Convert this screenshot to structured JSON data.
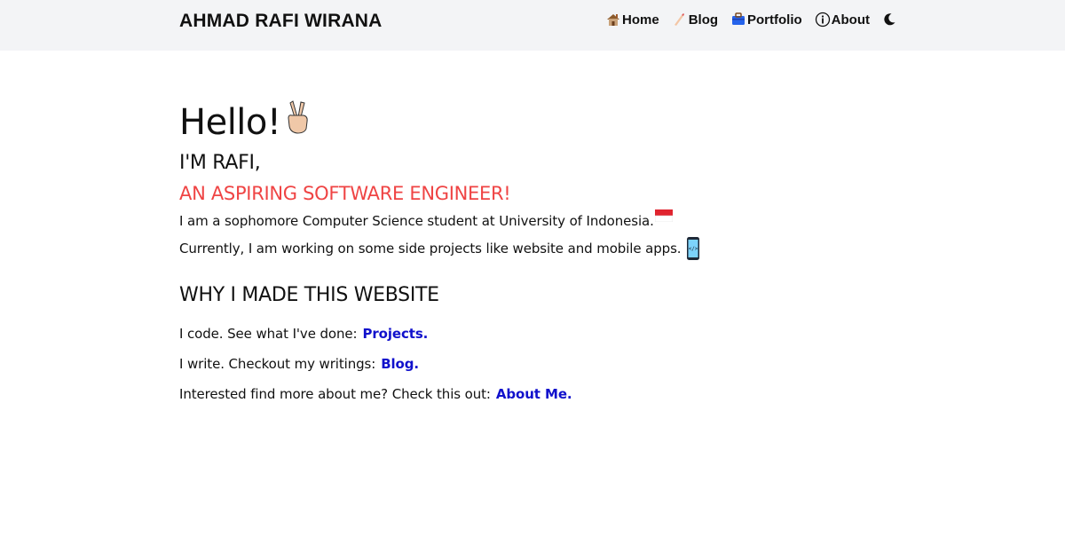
{
  "header": {
    "brand": "AHMAD RAFI WIRANA",
    "nav": [
      {
        "label": "Home",
        "icon": "house-icon"
      },
      {
        "label": "Blog",
        "icon": "writing-hand-icon"
      },
      {
        "label": "Portfolio",
        "icon": "briefcase-icon"
      },
      {
        "label": "About",
        "icon": "info-icon"
      }
    ],
    "theme_toggle_icon": "moon-icon"
  },
  "hero": {
    "greeting": "Hello!",
    "greeting_icon": "victory-hand-icon",
    "intro": "I'M RAFI,",
    "tagline": "AN ASPIRING SOFTWARE ENGINEER!",
    "tagline_color": "#ef4444",
    "paragraph1": "I am a sophomore Computer Science student at University of Indonesia.",
    "paragraph1_icon": "indonesia-flag-icon",
    "paragraph2": "Currently, I am working on some side projects like website and mobile apps.",
    "paragraph2_icon": "mobile-phone-icon"
  },
  "why": {
    "title": "WHY I MADE THIS WEBSITE",
    "lines": [
      {
        "text": "I code. See what I've done:",
        "link": "Projects."
      },
      {
        "text": "I write. Checkout my writings:",
        "link": "Blog."
      },
      {
        "text": "Interested find more about me? Check this out:",
        "link": "About Me."
      }
    ],
    "link_color": "#1111cc"
  }
}
